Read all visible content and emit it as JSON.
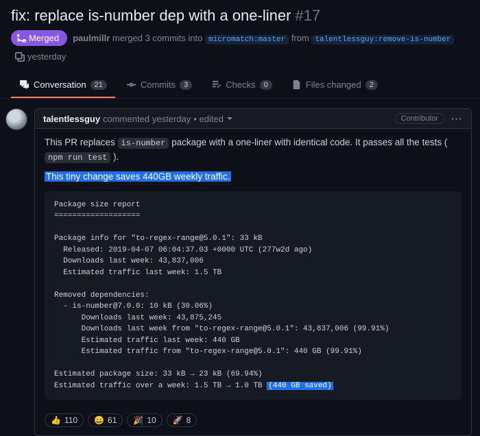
{
  "pr": {
    "title": "fix: replace is-number dep with a one-liner",
    "number": "#17",
    "state_label": "Merged",
    "merger": "paulmillr",
    "merge_text_mid": " merged 3 commits into ",
    "base_branch": "micromatch:master",
    "merge_text_from": " from ",
    "head_branch": "talentlessguy:remove-is-number",
    "merged_time": "yesterday"
  },
  "tabs": {
    "conversation": {
      "label": "Conversation",
      "count": "21"
    },
    "commits": {
      "label": "Commits",
      "count": "3"
    },
    "checks": {
      "label": "Checks",
      "count": "0"
    },
    "files": {
      "label": "Files changed",
      "count": "2"
    }
  },
  "comment": {
    "author": "talentlessguy",
    "action": " commented ",
    "time": "yesterday",
    "edited": " • edited",
    "role": "Contributor",
    "body_p1_a": "This PR replaces ",
    "body_p1_code": "is-number",
    "body_p1_b": " package with a one-liner with identical code. It passes all the tests ( ",
    "body_p1_code2": "npm run test",
    "body_p1_c": " ).",
    "body_p2_highlight": "This tiny change saves 440GB weekly traffic.",
    "code_pre": "Package size report\n===================\n\nPackage info for \"to-regex-range@5.0.1\": 33 kB\n  Released: 2019-04-07 06:04:37.03 +0000 UTC (277w2d ago)\n  Downloads last week: 43,837,006\n  Estimated traffic last week: 1.5 TB\n\nRemoved dependencies:\n  - is-number@7.0.0: 10 kB (30.06%)\n      Downloads last week: 43,875,245\n      Downloads last week from \"to-regex-range@5.0.1\": 43,837,006 (99.91%)\n      Estimated traffic last week: 440 GB\n      Estimated traffic from \"to-regex-range@5.0.1\": 440 GB (99.91%)\n\nEstimated package size: 33 kB → 23 kB (69.94%)\nEstimated traffic over a week: 1.5 TB → 1.0 TB ",
    "code_hl": "(440 GB saved)"
  },
  "reactions": [
    {
      "emoji": "👍",
      "count": "110"
    },
    {
      "emoji": "😄",
      "count": "61"
    },
    {
      "emoji": "🎉",
      "count": "10"
    },
    {
      "emoji": "🚀",
      "count": "8"
    }
  ]
}
